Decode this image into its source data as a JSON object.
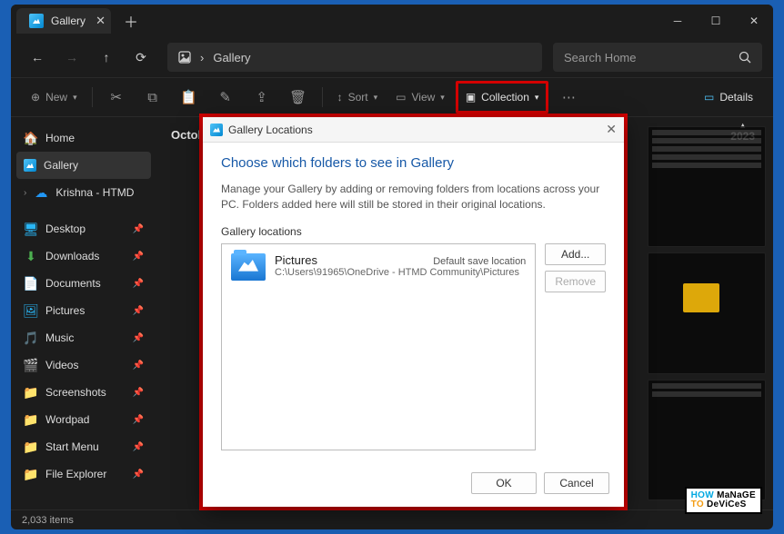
{
  "window_tab": {
    "title": "Gallery"
  },
  "breadcrumb": {
    "label": "Gallery"
  },
  "search": {
    "placeholder": "Search Home"
  },
  "toolbar": {
    "new_label": "New",
    "sort_label": "Sort",
    "view_label": "View",
    "collection_label": "Collection",
    "details_label": "Details"
  },
  "sidebar": {
    "items": [
      {
        "label": "Home",
        "icon": "🏠"
      },
      {
        "label": "Gallery",
        "icon": "gallery"
      },
      {
        "label": "Krishna - HTMD",
        "icon": "☁"
      }
    ],
    "pinned": [
      {
        "label": "Desktop",
        "icon": "🖥"
      },
      {
        "label": "Downloads",
        "icon": "⬇"
      },
      {
        "label": "Documents",
        "icon": "📄"
      },
      {
        "label": "Pictures",
        "icon": "🖼"
      },
      {
        "label": "Music",
        "icon": "🎵"
      },
      {
        "label": "Videos",
        "icon": "🎬"
      },
      {
        "label": "Screenshots",
        "icon": "📁"
      },
      {
        "label": "Wordpad",
        "icon": "📁"
      },
      {
        "label": "Start Menu",
        "icon": "📁"
      },
      {
        "label": "File Explorer",
        "icon": "📁"
      }
    ]
  },
  "content": {
    "section_header": "October",
    "year": "2023"
  },
  "statusbar": {
    "items_count": "2,033 items"
  },
  "dialog": {
    "title": "Gallery Locations",
    "heading": "Choose which folders to see in Gallery",
    "description": "Manage your Gallery by adding or removing folders from locations across your PC. Folders added here will still be stored in their original locations.",
    "section_label": "Gallery locations",
    "location": {
      "name": "Pictures",
      "path": "C:\\Users\\91965\\OneDrive - HTMD Community\\Pictures",
      "default_label": "Default save location"
    },
    "buttons": {
      "add": "Add...",
      "remove": "Remove",
      "ok": "OK",
      "cancel": "Cancel"
    }
  },
  "watermark": {
    "line1": "HOW",
    "line2": "TO",
    "brand1": "MaNaGE",
    "brand2": "DeViCeS"
  }
}
